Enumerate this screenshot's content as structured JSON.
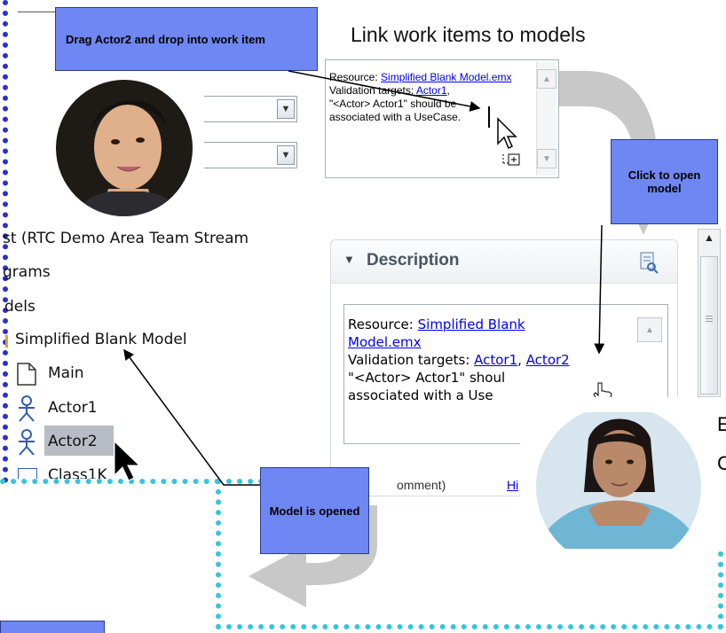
{
  "callouts": {
    "drag_actor2": "Drag Actor2 and drop into work item",
    "click_to_open": "Click to open model",
    "model_opened": "Model is opened"
  },
  "heading": "Link work items to models",
  "mini_textbox": {
    "resource_label": "Resource:",
    "resource_link": "Simplified Blank Model.emx",
    "validation_label": "Validation targets:",
    "actor1_link": "Actor1",
    "sep": ",",
    "message_line1": "\"<Actor> Actor1\" should be",
    "message_line2": "associated with a UseCase."
  },
  "description": {
    "header": "Description",
    "resource_label": "Resource:",
    "resource_link_line1": "Simplified Blank",
    "resource_link_line2": "Model.emx",
    "validation_label": "Validation targets:",
    "actor1_link": "Actor1",
    "comma": ",",
    "actor2_link": "Actor2",
    "message_line1": "\"<Actor> Actor1\" shoul",
    "message_line2": "associated with a Use",
    "footer_tab1": "omment)",
    "footer_tab2": "Hi"
  },
  "tree": {
    "stream": "st (RTC Demo Area Team Stream",
    "diagrams": "grams",
    "models": "dels",
    "model_name": "Simplified Blank Model",
    "items": [
      "Main",
      "Actor1",
      "Actor2",
      "Class1K"
    ]
  },
  "edge_letters": [
    "E",
    "C"
  ],
  "colors": {
    "callout": "#6f87f2",
    "dotted_border_left": "#2b2fd4",
    "dotted_border_bottom": "#35c6d8",
    "arrow_gray": "#c8c8c8",
    "selection": "#b8bcc4"
  }
}
